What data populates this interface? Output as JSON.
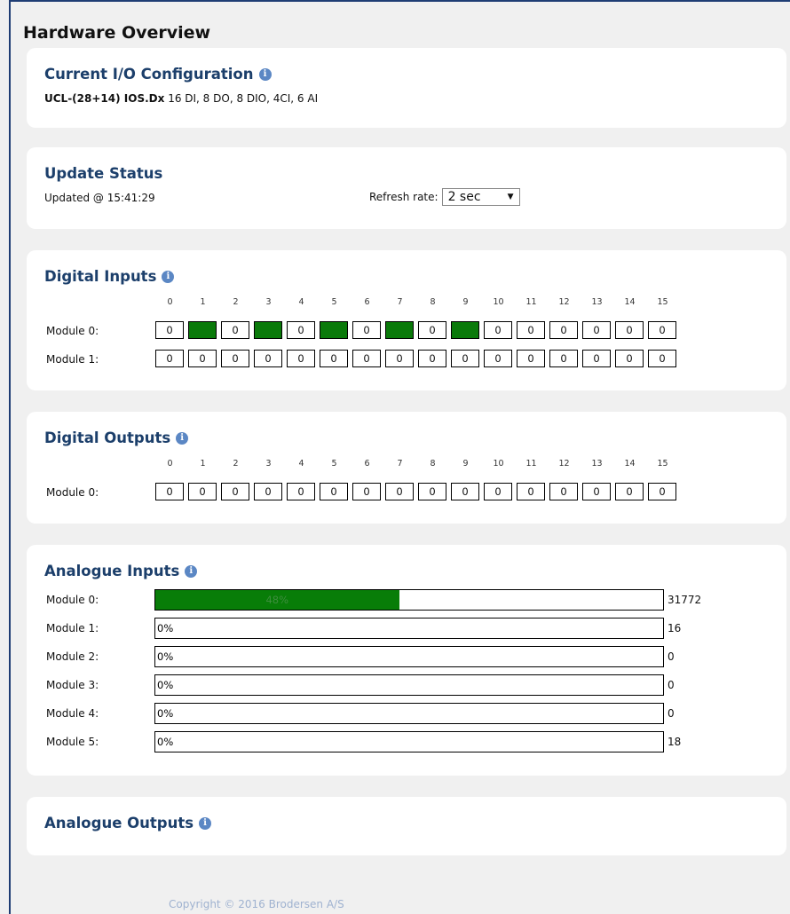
{
  "page_title": "Hardware Overview",
  "io_config": {
    "title": "Current I/O Configuration",
    "config_name": "UCL-(28+14) IOS.Dx",
    "config_detail": "16 DI, 8 DO, 8 DIO, 4CI, 6 AI"
  },
  "update_status": {
    "title": "Update Status",
    "updated_text": "Updated @ 15:41:29",
    "refresh_label": "Refresh rate:",
    "refresh_value": "2 sec"
  },
  "digital_inputs": {
    "title": "Digital Inputs",
    "columns": [
      "0",
      "1",
      "2",
      "3",
      "4",
      "5",
      "6",
      "7",
      "8",
      "9",
      "10",
      "11",
      "12",
      "13",
      "14",
      "15"
    ],
    "modules": [
      {
        "label": "Module 0:",
        "bits": [
          "0",
          "1",
          "0",
          "1",
          "0",
          "1",
          "0",
          "1",
          "0",
          "1",
          "0",
          "0",
          "0",
          "0",
          "0",
          "0"
        ]
      },
      {
        "label": "Module 1:",
        "bits": [
          "0",
          "0",
          "0",
          "0",
          "0",
          "0",
          "0",
          "0",
          "0",
          "0",
          "0",
          "0",
          "0",
          "0",
          "0",
          "0"
        ]
      }
    ]
  },
  "digital_outputs": {
    "title": "Digital Outputs",
    "columns": [
      "0",
      "1",
      "2",
      "3",
      "4",
      "5",
      "6",
      "7",
      "8",
      "9",
      "10",
      "11",
      "12",
      "13",
      "14",
      "15"
    ],
    "modules": [
      {
        "label": "Module 0:",
        "bits": [
          "0",
          "0",
          "0",
          "0",
          "0",
          "0",
          "0",
          "0",
          "0",
          "0",
          "0",
          "0",
          "0",
          "0",
          "0",
          "0"
        ]
      }
    ]
  },
  "analogue_inputs": {
    "title": "Analogue Inputs",
    "fill_color": "#087d08",
    "modules": [
      {
        "label": "Module 0:",
        "percent": 48,
        "percent_text": "48%",
        "value": "31772"
      },
      {
        "label": "Module 1:",
        "percent": 0,
        "percent_text": "0%",
        "value": "16"
      },
      {
        "label": "Module 2:",
        "percent": 0,
        "percent_text": "0%",
        "value": "0"
      },
      {
        "label": "Module 3:",
        "percent": 0,
        "percent_text": "0%",
        "value": "0"
      },
      {
        "label": "Module 4:",
        "percent": 0,
        "percent_text": "0%",
        "value": "0"
      },
      {
        "label": "Module 5:",
        "percent": 0,
        "percent_text": "0%",
        "value": "18"
      }
    ]
  },
  "analogue_outputs": {
    "title": "Analogue Outputs"
  },
  "footer": "Copyright © 2016 Brodersen A/S"
}
